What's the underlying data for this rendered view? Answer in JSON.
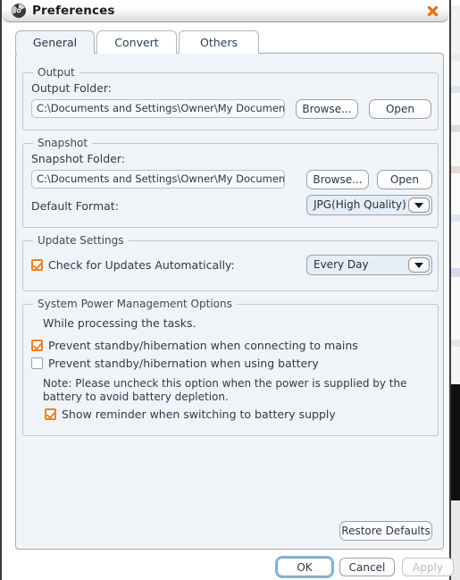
{
  "window": {
    "title": "Preferences",
    "icon": "disc-icon",
    "close_label": "✕",
    "accent_orange": "#ee7f22",
    "focus_blue": "#79b8e8",
    "panel_bg": "#f0f4f8"
  },
  "tabs": [
    {
      "id": "general",
      "label": "General",
      "active": true
    },
    {
      "id": "convert",
      "label": "Convert",
      "active": false
    },
    {
      "id": "others",
      "label": "Others",
      "active": false
    }
  ],
  "general": {
    "output": {
      "group_title": "Output",
      "folder_label": "Output Folder:",
      "folder_value": "C:\\Documents and Settings\\Owner\\My Documents\\My Vid",
      "browse_label": "Browse...",
      "open_label": "Open"
    },
    "snapshot": {
      "group_title": "Snapshot",
      "folder_label": "Snapshot Folder:",
      "folder_value": "C:\\Documents and Settings\\Owner\\My Documents\\My Pic",
      "browse_label": "Browse...",
      "open_label": "Open",
      "format_label": "Default Format:",
      "format_value": "JPG(High Quality)"
    },
    "update": {
      "group_title": "Update Settings",
      "auto_check_label": "Check for Updates Automatically:",
      "auto_check_checked": true,
      "frequency_value": "Every Day"
    },
    "power": {
      "group_title": "System Power Management Options",
      "intro_text": "While processing the tasks.",
      "prevent_mains_label": "Prevent standby/hibernation when connecting to mains",
      "prevent_mains_checked": true,
      "prevent_battery_label": "Prevent standby/hibernation when using battery",
      "prevent_battery_checked": false,
      "note_text": "Note: Please uncheck this option when the power is supplied by the battery to avoid battery depletion.",
      "reminder_label": "Show reminder when switching to battery supply",
      "reminder_checked": true
    },
    "restore_defaults_label": "Restore Defaults"
  },
  "footer": {
    "ok_label": "OK",
    "cancel_label": "Cancel",
    "apply_label": "Apply",
    "apply_enabled": false
  }
}
